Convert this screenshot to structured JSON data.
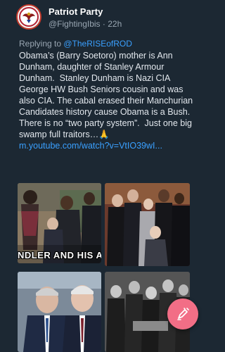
{
  "post": {
    "author": "Patriot Party",
    "handle": "@FightingIbis",
    "separator": "·",
    "age": "22h",
    "reply_prefix": "Replying to ",
    "reply_to": "@TheRISEofROD",
    "text": "Obama’s (Barry Soetoro) mother is Ann Dunham, daughter of Stanley Armour Dunham.  Stanley Dunham is Nazi CIA George HW Bush Seniors cousin and was also CIA. The cabal erased their Manchurian Candidates history cause Obama is a Bush.  There is no “two party system”.  Just one big swamp full traitors…🙏 ",
    "link": "m.youtube.com/watch?v=VtIO39wI...",
    "image_caption": "NDLER AND HIS A"
  },
  "icons": {
    "avatar": "eagle-emblem-icon",
    "compose": "compose-feather-icon"
  },
  "colors": {
    "background": "#1c2833",
    "link": "#3aa0ff",
    "fab": "#f26e86"
  }
}
